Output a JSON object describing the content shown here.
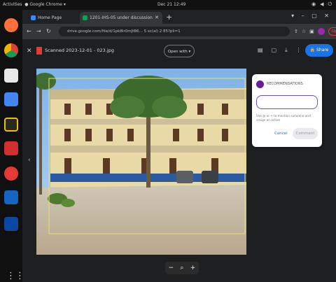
{
  "system_bar": {
    "activities": "Activities",
    "app": "Google Chrome",
    "clock": "Dec 21 12:49"
  },
  "browser": {
    "tabs": [
      {
        "label": "Home Page"
      },
      {
        "label": "1201-IHS-05 under discussion"
      }
    ],
    "new_tab": "+",
    "address": "drive.google.com/file/d/1pk8Ir0mJtB6... 5 sc(al) 2 85?pli=1",
    "update_label": "Update"
  },
  "viewer": {
    "filename": "Scanned 2023-12-01 - 023.jpg",
    "open_with": "Open with",
    "share_label": "Share",
    "zoom": {
      "minus": "−",
      "search": "⌕",
      "plus": "+"
    }
  },
  "comment_popup": {
    "user": "RECOMMENDATIONS",
    "hint": "Use @ or + to mention someone and assign an action",
    "cancel": "Cancel",
    "comment": "Comment"
  },
  "icons": {
    "dock": [
      "firefox-icon",
      "chrome-icon",
      "files-icon",
      "docs-icon",
      "security-icon",
      "pdf-icon",
      "record-icon",
      "outlook-icon",
      "drive-icon"
    ],
    "grid": "apps-grid-icon"
  },
  "colors": {
    "accent": "#1a73e8",
    "popup_focus": "#6a4ad8",
    "avatar": "#9c27b0",
    "update": "#e53935"
  }
}
